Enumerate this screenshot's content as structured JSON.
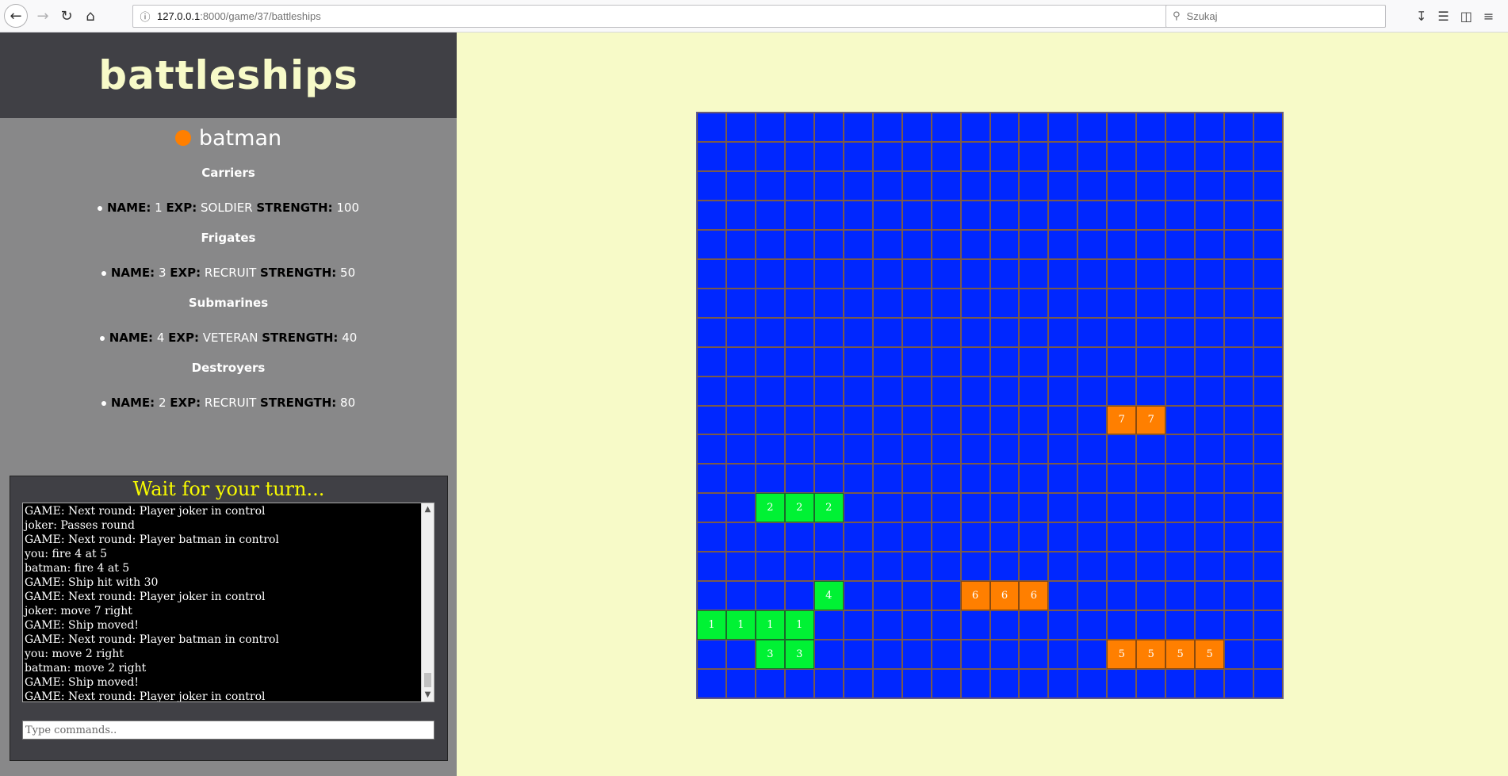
{
  "browser": {
    "url_host": "127.0.0.1",
    "url_path": ":8000/game/37/battleships",
    "search_placeholder": "Szukaj",
    "icons": [
      "back-icon",
      "forward-icon",
      "reload-icon",
      "home-icon",
      "info-icon",
      "more-icon",
      "pocket-icon",
      "star-icon",
      "search-icon",
      "download-icon",
      "library-icon",
      "sidebar-icon",
      "menu-icon"
    ]
  },
  "app": {
    "title": "battleships",
    "player_name": "batman",
    "player_color": "#ff7f00"
  },
  "labels": {
    "name": "NAME:",
    "exp": "EXP:",
    "strength": "STRENGTH:"
  },
  "fleet": [
    {
      "group": "Carriers",
      "name": "1",
      "exp": "SOLDIER",
      "strength": "100"
    },
    {
      "group": "Frigates",
      "name": "3",
      "exp": "RECRUIT",
      "strength": "50"
    },
    {
      "group": "Submarines",
      "name": "4",
      "exp": "VETERAN",
      "strength": "40"
    },
    {
      "group": "Destroyers",
      "name": "2",
      "exp": "RECRUIT",
      "strength": "80"
    }
  ],
  "console": {
    "status": "Wait for your turn...",
    "log": [
      "GAME: Next round: Player joker in control",
      "joker: Passes round",
      "GAME: Next round: Player batman in control",
      "you: fire 4 at 5",
      "batman: fire 4 at 5",
      "GAME: Ship hit with 30",
      "GAME: Next round: Player joker in control",
      "joker: move 7 right",
      "GAME: Ship moved!",
      "GAME: Next round: Player batman in control",
      "you: move 2 right",
      "batman: move 2 right",
      "GAME: Ship moved!",
      "GAME: Next round: Player joker in control"
    ],
    "input_placeholder": "Type commands.."
  },
  "board": {
    "size": 20,
    "colors": {
      "water": "#0027ff",
      "own": "#00f234",
      "enemy": "#ff7f00"
    },
    "ships": [
      {
        "label": "1",
        "owner": "own",
        "cells": [
          [
            17,
            0
          ],
          [
            17,
            1
          ],
          [
            17,
            2
          ],
          [
            17,
            3
          ]
        ]
      },
      {
        "label": "2",
        "owner": "own",
        "cells": [
          [
            13,
            2
          ],
          [
            13,
            3
          ],
          [
            13,
            4
          ]
        ]
      },
      {
        "label": "3",
        "owner": "own",
        "cells": [
          [
            18,
            2
          ],
          [
            18,
            3
          ]
        ]
      },
      {
        "label": "4",
        "owner": "own",
        "cells": [
          [
            16,
            4
          ]
        ]
      },
      {
        "label": "5",
        "owner": "enemy",
        "cells": [
          [
            18,
            14
          ],
          [
            18,
            15
          ],
          [
            18,
            16
          ],
          [
            18,
            17
          ]
        ]
      },
      {
        "label": "6",
        "owner": "enemy",
        "cells": [
          [
            16,
            9
          ],
          [
            16,
            10
          ],
          [
            16,
            11
          ]
        ]
      },
      {
        "label": "7",
        "owner": "enemy",
        "cells": [
          [
            10,
            14
          ],
          [
            10,
            15
          ]
        ]
      }
    ]
  }
}
